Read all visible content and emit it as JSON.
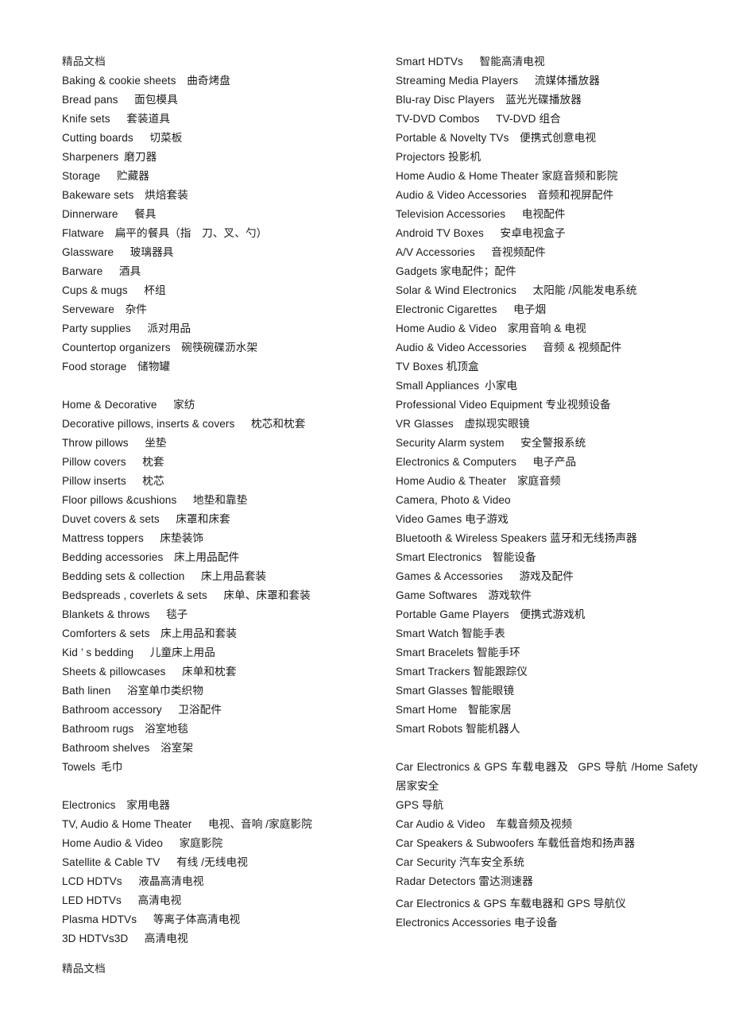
{
  "document": {
    "header_text": "精品文档",
    "footer_text": "精品文档"
  },
  "left_column": {
    "lines": [
      "Baking & cookie sheets 曲奇烤盘",
      "Bread pans  面包模具",
      "Knife sets  套装道具",
      "Cutting boards  切菜板",
      "Sharpeners 磨刀器",
      "Storage  贮藏器",
      "Bakeware sets 烘焙套装",
      "Dinnerware  餐具",
      "Flatware 扁平的餐具（指 刀、叉、勺）",
      "Glassware  玻璃器具",
      "Barware  酒具",
      "Cups & mugs  杯组",
      "Serveware 杂件",
      "Party supplies  派对用品",
      "Countertop organizers 碗筷碗碟沥水架",
      "Food storage 储物罐",
      "",
      "Home & Decorative  家纺",
      "Decorative pillows, inserts & covers  枕芯和枕套",
      "Throw pillows  坐垫",
      "Pillow covers  枕套",
      "Pillow inserts  枕芯",
      "Floor pillows &cushions  地垫和靠垫",
      "Duvet covers & sets  床罩和床套",
      "Mattress toppers  床垫装饰",
      "Bedding accessories 床上用品配件",
      "Bedding sets & collection  床上用品套装",
      "Bedspreads , coverlets & sets  床单、床罩和套装",
      "Blankets & throws  毯子",
      "Comforters & sets 床上用品和套装",
      "Kid ’ s bedding  儿童床上用品",
      "Sheets & pillowcases  床单和枕套",
      "Bath linen  浴室单巾类织物",
      "Bathroom accessory  卫浴配件",
      "Bathroom rugs 浴室地毯",
      "Bathroom shelves 浴室架",
      "Towels 毛巾",
      "",
      "Electronics 家用电器",
      "TV, Audio & Home Theater  电视、音响 /家庭影院",
      "Home Audio & Video  家庭影院",
      "Satellite & Cable TV  有线 /无线电视",
      "LCD HDTVs  液晶高清电视",
      "LED HDTVs  高清电视",
      "Plasma HDTVs  等离子体高清电视",
      "3D HDTVs3D  高清电视"
    ]
  },
  "right_column": {
    "lines": [
      "Smart HDTVs  智能高清电视",
      "Streaming Media Players  流媒体播放器",
      "Blu-ray Disc Players 蓝光光碟播放器",
      "TV-DVD Combos  TV-DVD 组合",
      "Portable & Novelty TVs 便携式创意电视",
      "Projectors 投影机",
      "Home Audio & Home Theater 家庭音频和影院",
      "Audio & Video Accessories 音频和视屏配件",
      "Television Accessories  电视配件",
      "Android TV Boxes  安卓电视盒子",
      "A/V Accessories  音视频配件",
      "Gadgets 家电配件；配件",
      "Solar & Wind Electronics  太阳能 /风能发电系统",
      "Electronic Cigarettes  电子烟",
      "Home Audio & Video 家用音响 & 电视",
      "Audio & Video Accessories  音频 & 视频配件",
      "TV Boxes 机顶盒",
      "Small Appliances 小家电",
      "Professional Video Equipment 专业视频设备",
      "VR Glasses 虚拟现实眼镜",
      "Security Alarm system  安全警报系统",
      "Electronics & Computers  电子产品",
      "Home Audio & Theater 家庭音频",
      "Camera, Photo & Video",
      "Video Games 电子游戏",
      "Bluetooth & Wireless Speakers 蓝牙和无线扬声器",
      "Smart Electronics 智能设备",
      "Games & Accessories  游戏及配件",
      "Game Softwares 游戏软件",
      "Portable Game Players 便携式游戏机",
      "Smart Watch 智能手表",
      "Smart Bracelets 智能手环",
      "Smart Trackers 智能跟踪仪",
      "Smart Glasses 智能眼镜",
      "Smart Home 智能家居",
      "Smart Robots 智能机器人"
    ],
    "wrapped_entry": "Car  Electronics  &  GPS 车载电器及   GPS 导航 /Home Safety  居家安全",
    "lines_tail": [
      "GPS 导航",
      "Car Audio & Video 车载音频及视频",
      "Car Speakers & Subwoofers 车载低音炮和扬声器",
      "Car Security 汽车安全系统",
      "Radar Detectors 雷达测速器",
      "Car Electronics & GPS 车载电器和 GPS 导航仪",
      "Electronics Accessories 电子设备"
    ]
  }
}
